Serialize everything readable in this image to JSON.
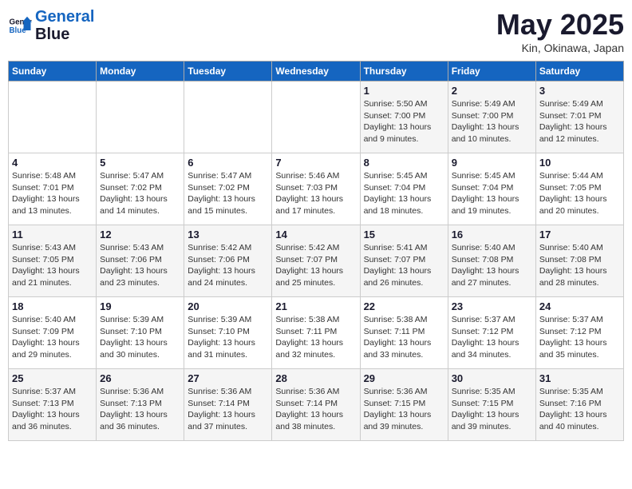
{
  "header": {
    "logo_line1": "General",
    "logo_line2": "Blue",
    "month": "May 2025",
    "location": "Kin, Okinawa, Japan"
  },
  "weekdays": [
    "Sunday",
    "Monday",
    "Tuesday",
    "Wednesday",
    "Thursday",
    "Friday",
    "Saturday"
  ],
  "weeks": [
    [
      {
        "day": "",
        "info": ""
      },
      {
        "day": "",
        "info": ""
      },
      {
        "day": "",
        "info": ""
      },
      {
        "day": "",
        "info": ""
      },
      {
        "day": "1",
        "info": "Sunrise: 5:50 AM\nSunset: 7:00 PM\nDaylight: 13 hours\nand 9 minutes."
      },
      {
        "day": "2",
        "info": "Sunrise: 5:49 AM\nSunset: 7:00 PM\nDaylight: 13 hours\nand 10 minutes."
      },
      {
        "day": "3",
        "info": "Sunrise: 5:49 AM\nSunset: 7:01 PM\nDaylight: 13 hours\nand 12 minutes."
      }
    ],
    [
      {
        "day": "4",
        "info": "Sunrise: 5:48 AM\nSunset: 7:01 PM\nDaylight: 13 hours\nand 13 minutes."
      },
      {
        "day": "5",
        "info": "Sunrise: 5:47 AM\nSunset: 7:02 PM\nDaylight: 13 hours\nand 14 minutes."
      },
      {
        "day": "6",
        "info": "Sunrise: 5:47 AM\nSunset: 7:02 PM\nDaylight: 13 hours\nand 15 minutes."
      },
      {
        "day": "7",
        "info": "Sunrise: 5:46 AM\nSunset: 7:03 PM\nDaylight: 13 hours\nand 17 minutes."
      },
      {
        "day": "8",
        "info": "Sunrise: 5:45 AM\nSunset: 7:04 PM\nDaylight: 13 hours\nand 18 minutes."
      },
      {
        "day": "9",
        "info": "Sunrise: 5:45 AM\nSunset: 7:04 PM\nDaylight: 13 hours\nand 19 minutes."
      },
      {
        "day": "10",
        "info": "Sunrise: 5:44 AM\nSunset: 7:05 PM\nDaylight: 13 hours\nand 20 minutes."
      }
    ],
    [
      {
        "day": "11",
        "info": "Sunrise: 5:43 AM\nSunset: 7:05 PM\nDaylight: 13 hours\nand 21 minutes."
      },
      {
        "day": "12",
        "info": "Sunrise: 5:43 AM\nSunset: 7:06 PM\nDaylight: 13 hours\nand 23 minutes."
      },
      {
        "day": "13",
        "info": "Sunrise: 5:42 AM\nSunset: 7:06 PM\nDaylight: 13 hours\nand 24 minutes."
      },
      {
        "day": "14",
        "info": "Sunrise: 5:42 AM\nSunset: 7:07 PM\nDaylight: 13 hours\nand 25 minutes."
      },
      {
        "day": "15",
        "info": "Sunrise: 5:41 AM\nSunset: 7:07 PM\nDaylight: 13 hours\nand 26 minutes."
      },
      {
        "day": "16",
        "info": "Sunrise: 5:40 AM\nSunset: 7:08 PM\nDaylight: 13 hours\nand 27 minutes."
      },
      {
        "day": "17",
        "info": "Sunrise: 5:40 AM\nSunset: 7:08 PM\nDaylight: 13 hours\nand 28 minutes."
      }
    ],
    [
      {
        "day": "18",
        "info": "Sunrise: 5:40 AM\nSunset: 7:09 PM\nDaylight: 13 hours\nand 29 minutes."
      },
      {
        "day": "19",
        "info": "Sunrise: 5:39 AM\nSunset: 7:10 PM\nDaylight: 13 hours\nand 30 minutes."
      },
      {
        "day": "20",
        "info": "Sunrise: 5:39 AM\nSunset: 7:10 PM\nDaylight: 13 hours\nand 31 minutes."
      },
      {
        "day": "21",
        "info": "Sunrise: 5:38 AM\nSunset: 7:11 PM\nDaylight: 13 hours\nand 32 minutes."
      },
      {
        "day": "22",
        "info": "Sunrise: 5:38 AM\nSunset: 7:11 PM\nDaylight: 13 hours\nand 33 minutes."
      },
      {
        "day": "23",
        "info": "Sunrise: 5:37 AM\nSunset: 7:12 PM\nDaylight: 13 hours\nand 34 minutes."
      },
      {
        "day": "24",
        "info": "Sunrise: 5:37 AM\nSunset: 7:12 PM\nDaylight: 13 hours\nand 35 minutes."
      }
    ],
    [
      {
        "day": "25",
        "info": "Sunrise: 5:37 AM\nSunset: 7:13 PM\nDaylight: 13 hours\nand 36 minutes."
      },
      {
        "day": "26",
        "info": "Sunrise: 5:36 AM\nSunset: 7:13 PM\nDaylight: 13 hours\nand 36 minutes."
      },
      {
        "day": "27",
        "info": "Sunrise: 5:36 AM\nSunset: 7:14 PM\nDaylight: 13 hours\nand 37 minutes."
      },
      {
        "day": "28",
        "info": "Sunrise: 5:36 AM\nSunset: 7:14 PM\nDaylight: 13 hours\nand 38 minutes."
      },
      {
        "day": "29",
        "info": "Sunrise: 5:36 AM\nSunset: 7:15 PM\nDaylight: 13 hours\nand 39 minutes."
      },
      {
        "day": "30",
        "info": "Sunrise: 5:35 AM\nSunset: 7:15 PM\nDaylight: 13 hours\nand 39 minutes."
      },
      {
        "day": "31",
        "info": "Sunrise: 5:35 AM\nSunset: 7:16 PM\nDaylight: 13 hours\nand 40 minutes."
      }
    ]
  ]
}
